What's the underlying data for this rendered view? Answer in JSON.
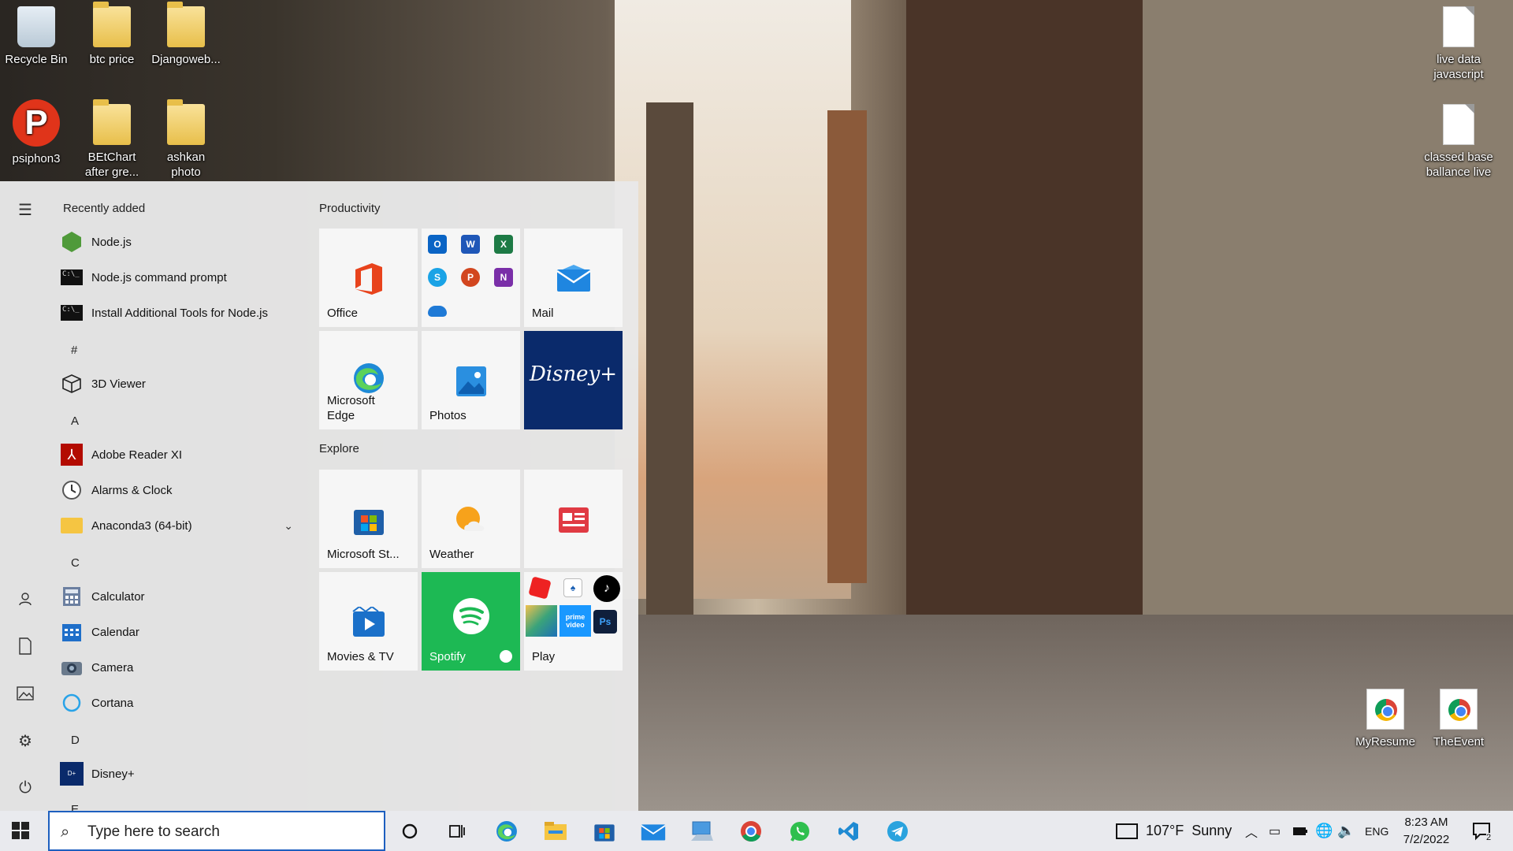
{
  "desktop": {
    "icons_left": [
      {
        "label": "Recycle Bin",
        "icon": "recycle-bin-icon"
      },
      {
        "label": "btc price",
        "icon": "folder-icon"
      },
      {
        "label": "Djangoweb...",
        "icon": "folder-icon"
      },
      {
        "label": "psiphon3",
        "icon": "psiphon-icon"
      },
      {
        "label": "BEtChart after gre...",
        "icon": "folder-icon"
      },
      {
        "label": "ashkan photo",
        "icon": "folder-icon"
      }
    ],
    "icons_right": [
      {
        "label": "live data javascript",
        "icon": "document-icon"
      },
      {
        "label": "classed base ballance live",
        "icon": "document-icon"
      },
      {
        "label": "MyResume",
        "icon": "chrome-html-icon"
      },
      {
        "label": "TheEvent",
        "icon": "chrome-html-icon"
      }
    ]
  },
  "start_menu": {
    "recently_added_label": "Recently added",
    "recent": [
      {
        "label": "Node.js",
        "icon": "nodejs-icon"
      },
      {
        "label": "Node.js command prompt",
        "icon": "cmd-icon"
      },
      {
        "label": "Install Additional Tools for Node.js",
        "icon": "cmd-icon"
      }
    ],
    "sections": [
      {
        "letter": "#",
        "apps": [
          {
            "label": "3D Viewer",
            "icon": "cube-icon"
          }
        ]
      },
      {
        "letter": "A",
        "apps": [
          {
            "label": "Adobe Reader XI",
            "icon": "adobe-reader-icon"
          },
          {
            "label": "Alarms & Clock",
            "icon": "clock-icon"
          },
          {
            "label": "Anaconda3 (64-bit)",
            "icon": "folder-icon",
            "expandable": true
          }
        ]
      },
      {
        "letter": "C",
        "apps": [
          {
            "label": "Calculator",
            "icon": "calculator-icon"
          },
          {
            "label": "Calendar",
            "icon": "calendar-icon"
          },
          {
            "label": "Camera",
            "icon": "camera-icon"
          },
          {
            "label": "Cortana",
            "icon": "cortana-icon"
          }
        ]
      },
      {
        "letter": "D",
        "apps": [
          {
            "label": "Disney+",
            "icon": "disney-icon"
          }
        ]
      },
      {
        "letter": "E",
        "apps": []
      }
    ],
    "groups": {
      "productivity": "Productivity",
      "explore": "Explore"
    },
    "tiles": {
      "office": "Office",
      "mail": "Mail",
      "edge": "Microsoft Edge",
      "photos": "Photos",
      "store": "Microsoft St...",
      "weather": "Weather",
      "movies": "Movies & TV",
      "spotify": "Spotify",
      "play": "Play"
    },
    "office_mini_apps": [
      "Outlook",
      "Word",
      "Excel",
      "Skype",
      "PowerPoint",
      "OneNote",
      "OneDrive"
    ]
  },
  "taskbar": {
    "search_placeholder": "Type here to search",
    "weather_text": "107°F  Sunny",
    "language": "ENG",
    "time": "8:23 AM",
    "date": "7/2/2022",
    "notification_count": "2"
  },
  "colors": {
    "accent": "#1d5fbf",
    "spotify_green": "#1db954",
    "disney_blue": "#0a2a6b"
  }
}
